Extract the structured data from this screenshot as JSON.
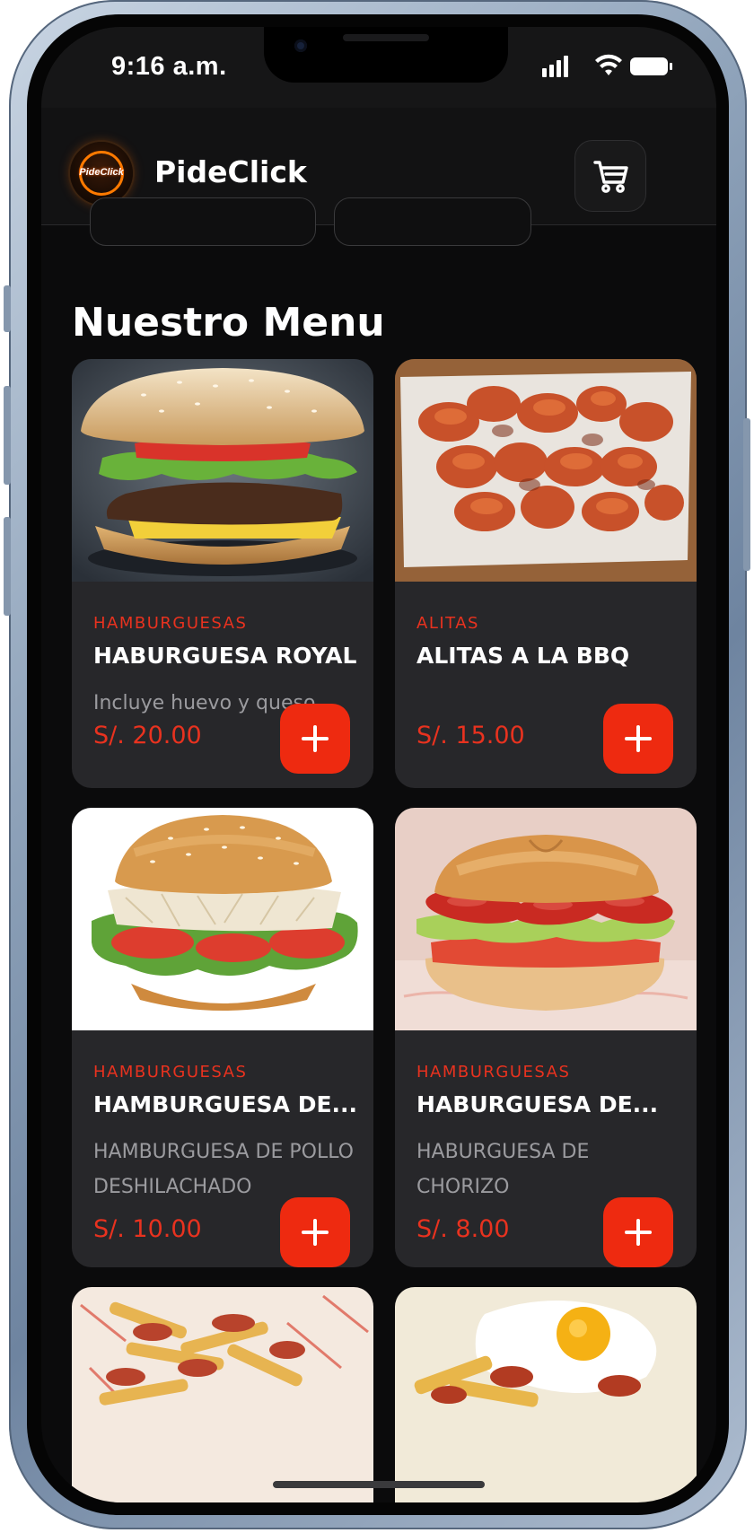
{
  "status_bar": {
    "time": "9:16 a.m.",
    "icons": [
      "signal-icon",
      "wifi-icon",
      "battery-icon"
    ]
  },
  "app_bar": {
    "logo_text": "PideClick",
    "brand": "PideClick",
    "cart_icon": "cart-icon"
  },
  "menu": {
    "title": "Nuestro Menu",
    "items": [
      {
        "category": "HAMBURGUESAS",
        "name": "HABURGUESA ROYAL",
        "description": "Incluye huevo y queso",
        "price": "S/. 20.00",
        "image": "burger-with-cheese-lettuce-tomato"
      },
      {
        "category": "ALITAS",
        "name": "ALITAS A LA BBQ",
        "description": "",
        "price": "S/. 15.00",
        "image": "bbq-chicken-wings"
      },
      {
        "category": "HAMBURGUESAS",
        "name": "HAMBURGUESA DE...",
        "description": "HAMBURGUESA DE POLLO DESHILACHADO",
        "price": "S/. 10.00",
        "image": "shredded-chicken-burger"
      },
      {
        "category": "HAMBURGUESAS",
        "name": "HABURGUESA DE...",
        "description": "HABURGUESA DE CHORIZO",
        "price": "S/. 8.00",
        "image": "chorizo-burger"
      },
      {
        "image": "salchipapa-fries"
      },
      {
        "image": "fried-egg-plate"
      }
    ],
    "add_icon": "plus-icon"
  },
  "colors": {
    "accent": "#ee2a10",
    "category_text": "#e8321f",
    "background": "#0b0b0c",
    "card": "#27272a"
  }
}
